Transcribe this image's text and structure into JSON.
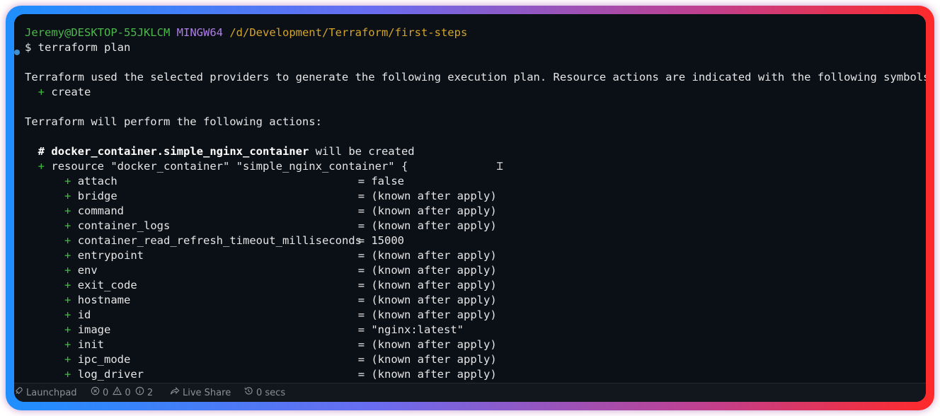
{
  "prompt": {
    "user_host": "Jeremy@DESKTOP-55JKLCM",
    "system": "MINGW64",
    "path": "/d/Development/Terraform/first-steps"
  },
  "command": "$ terraform plan",
  "intro_line": "Terraform used the selected providers to generate the following execution plan. Resource actions are indicated with the following symbols:",
  "symbol_plus": "+",
  "symbol_create_label": "create",
  "actions_heading": "Terraform will perform the following actions:",
  "resource_comment_hash": "#",
  "resource_comment_name": "docker_container.simple_nginx_container",
  "resource_comment_tail": "will be created",
  "resource_decl": "resource \"docker_container\" \"simple_nginx_container\" {",
  "attributes": [
    {
      "name": "attach",
      "value": "= false"
    },
    {
      "name": "bridge",
      "value": "= (known after apply)"
    },
    {
      "name": "command",
      "value": "= (known after apply)"
    },
    {
      "name": "container_logs",
      "value": "= (known after apply)"
    },
    {
      "name": "container_read_refresh_timeout_milliseconds",
      "value": "= 15000"
    },
    {
      "name": "entrypoint",
      "value": "= (known after apply)"
    },
    {
      "name": "env",
      "value": "= (known after apply)"
    },
    {
      "name": "exit_code",
      "value": "= (known after apply)"
    },
    {
      "name": "hostname",
      "value": "= (known after apply)"
    },
    {
      "name": "id",
      "value": "= (known after apply)"
    },
    {
      "name": "image",
      "value": "= \"nginx:latest\""
    },
    {
      "name": "init",
      "value": "= (known after apply)"
    },
    {
      "name": "ipc_mode",
      "value": "= (known after apply)"
    },
    {
      "name": "log_driver",
      "value": "= (known after apply)"
    }
  ],
  "statusbar": {
    "launchpad": "Launchpad",
    "errors": "0",
    "warnings": "0",
    "info": "2",
    "live_share": "Live Share",
    "timer": "0 secs"
  },
  "icons": {
    "launchpad": "rocket-icon",
    "errors": "error-circle-icon",
    "warnings": "warning-triangle-icon",
    "info": "info-circle-icon",
    "live_share": "live-share-icon",
    "timer": "history-clock-icon"
  },
  "colors": {
    "terminal_bg": "#0b0f16",
    "prompt_user": "#4cb84c",
    "prompt_system": "#b07ee8",
    "prompt_path": "#d4a52a",
    "plus_green": "#3fbf3f",
    "border_start": "#1f8fff",
    "border_end": "#ff2a2a"
  }
}
